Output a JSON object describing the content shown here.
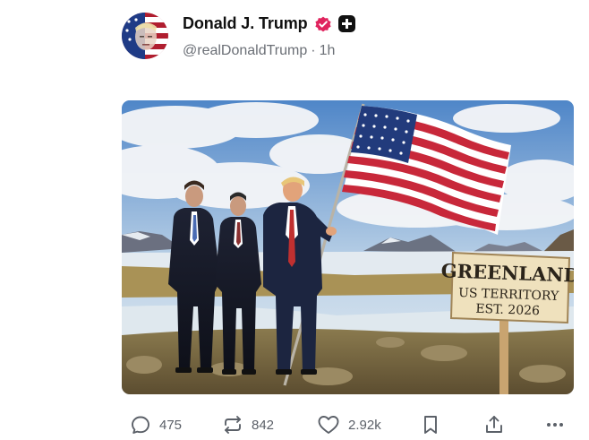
{
  "author": {
    "display_name": "Donald J. Trump",
    "handle": "@realDonaldTrump",
    "separator": "·",
    "time_ago": "1h",
    "verified_color": "#e0245e",
    "badge_color": "#111111"
  },
  "media": {
    "sign": {
      "line1": "GREENLAND",
      "line2": "US TERRITORY",
      "line3": "EST. 2026"
    }
  },
  "actions": {
    "reply_count": "475",
    "repost_count": "842",
    "like_count": "2.92k"
  },
  "icons": [
    "reply-icon",
    "repost-icon",
    "heart-icon",
    "bookmark-icon",
    "share-icon",
    "more-icon",
    "verified-icon",
    "plus-badge-icon"
  ]
}
